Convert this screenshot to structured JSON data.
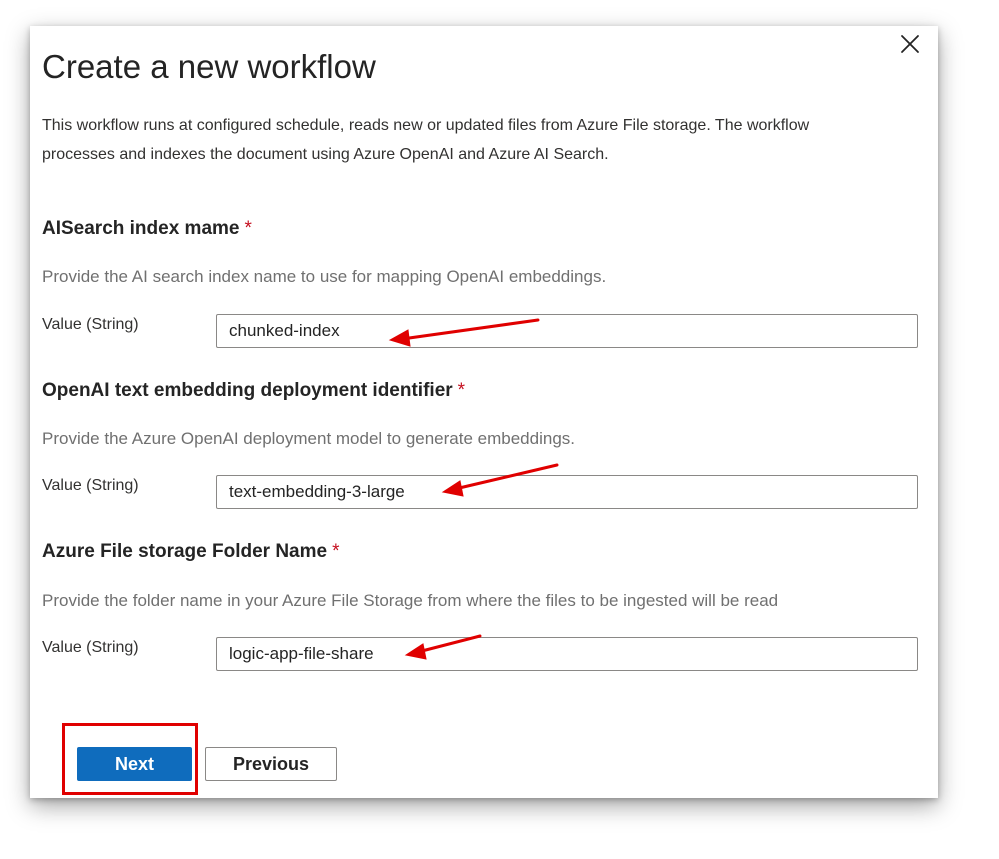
{
  "dialog": {
    "title": "Create a new workflow",
    "description": "This workflow runs at configured schedule, reads new or updated files from Azure File storage. The workflow processes and indexes the document using Azure OpenAI and Azure AI Search.",
    "close_icon": "close-icon"
  },
  "fields": [
    {
      "label": "AISearch index mame",
      "required": "*",
      "hint": "Provide the AI search index name to use for mapping OpenAI embeddings.",
      "value_label": "Value (String)",
      "value": "chunked-index"
    },
    {
      "label": "OpenAI text embedding deployment identifier",
      "required": "*",
      "hint": "Provide the Azure OpenAI deployment model to generate embeddings.",
      "value_label": "Value (String)",
      "value": "text-embedding-3-large"
    },
    {
      "label": "Azure File storage Folder Name",
      "required": "*",
      "hint": "Provide the folder name in your Azure File Storage from where the files to be ingested will be read",
      "value_label": "Value (String)",
      "value": "logic-app-file-share"
    }
  ],
  "buttons": {
    "next_label": "Next",
    "previous_label": "Previous"
  },
  "annotations": {
    "arrow_color": "#e00000",
    "highlight_color": "#e00000"
  },
  "colors": {
    "primary": "#0f6cbd",
    "required": "#c50f1f"
  }
}
